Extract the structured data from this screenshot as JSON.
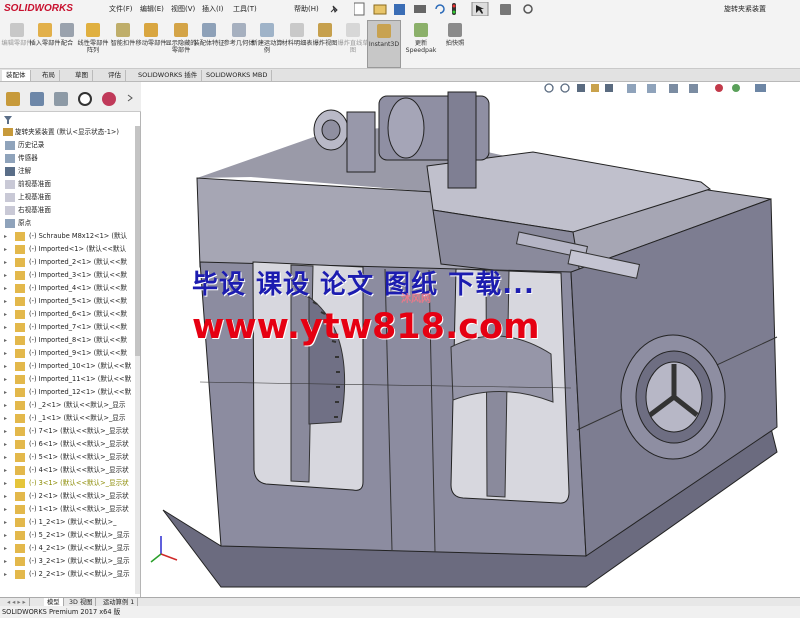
{
  "app": {
    "logo": "SOLIDWORKS",
    "doc_title": "旋转夹紧装置"
  },
  "menu": [
    "文件(F)",
    "编辑(E)",
    "视图(V)",
    "插入(I)",
    "工具(T)",
    "帮助(H)"
  ],
  "ribbon": [
    {
      "label": "编辑零部件",
      "disabled": true
    },
    {
      "label": "插入零部件"
    },
    {
      "label": "配合"
    },
    {
      "label": "线性零部件阵列"
    },
    {
      "label": "智能扣件"
    },
    {
      "label": "移动零部件"
    },
    {
      "label": "显示隐藏的零部件"
    },
    {
      "label": "装配体特征"
    },
    {
      "label": "参考几何体"
    },
    {
      "label": "新建运动算例"
    },
    {
      "label": "材料明细表"
    },
    {
      "label": "爆炸视图"
    },
    {
      "label": "爆炸直线草图",
      "disabled": true
    },
    {
      "label": "Instant3D",
      "active": true
    },
    {
      "label": "更新Speedpak"
    },
    {
      "label": "拍快照"
    }
  ],
  "command_tabs": [
    "装配体",
    "布局",
    "草图",
    "评估",
    "SOLIDWORKS 插件",
    "SOLIDWORKS MBD"
  ],
  "tree": {
    "root": "旋转夹紧装置 (默认<显示状态-1>)",
    "items": [
      "历史记录",
      "传感器",
      "注解",
      "前视基准面",
      "上视基准面",
      "右视基准面",
      "原点",
      "(-) Schraube M8x12<1> (默认",
      "(-) Imported<1> (默认<<默认",
      "(-) Imported_2<1> (默认<<默",
      "(-) Imported_3<1> (默认<<默",
      "(-) Imported_4<1> (默认<<默",
      "(-) Imported_5<1> (默认<<默",
      "(-) Imported_6<1> (默认<<默",
      "(-) Imported_7<1> (默认<<默",
      "(-) Imported_8<1> (默认<<默",
      "(-) Imported_9<1> (默认<<默",
      "(-) Imported_10<1> (默认<<默",
      "(-) Imported_11<1> (默认<<默",
      "(-) Imported_12<1> (默认<<默",
      "(-) _2<1> (默认<<默认>_显示",
      "(-) _1<1> (默认<<默认>_显示",
      "(-) 7<1> (默认<<默认>_显示状",
      "(-) 6<1> (默认<<默认>_显示状",
      "(-) 5<1> (默认<<默认>_显示状",
      "(-) 4<1> (默认<<默认>_显示状",
      "(-) 3<1> (默认<<默认>_显示状",
      "(-) 2<1> (默认<<默认>_显示状",
      "(-) 1<1> (默认<<默认>_显示状",
      "(-) 1_2<1> (默认<<默认>_",
      "(-) 5_2<1> (默认<<默认>_显示",
      "(-) 4_2<1> (默认<<默认>_显示",
      "(-) 3_2<1> (默认<<默认>_显示",
      "(-) 2_2<1> (默认<<默认>_显示"
    ]
  },
  "bottom_tabs": [
    "模型",
    "3D 视图",
    "运动算例 1"
  ],
  "status": "SOLIDWORKS Premium 2017 x64 版",
  "watermark": {
    "line1": "毕设 课设 论文 图纸 下载...",
    "line2": "www.ytw818.com",
    "small": "沐风网"
  },
  "colors": {
    "accent": "#c8102e",
    "model": "#7f7f93",
    "watermark_blue": "#1c1cb0",
    "watermark_red": "#e60012"
  }
}
